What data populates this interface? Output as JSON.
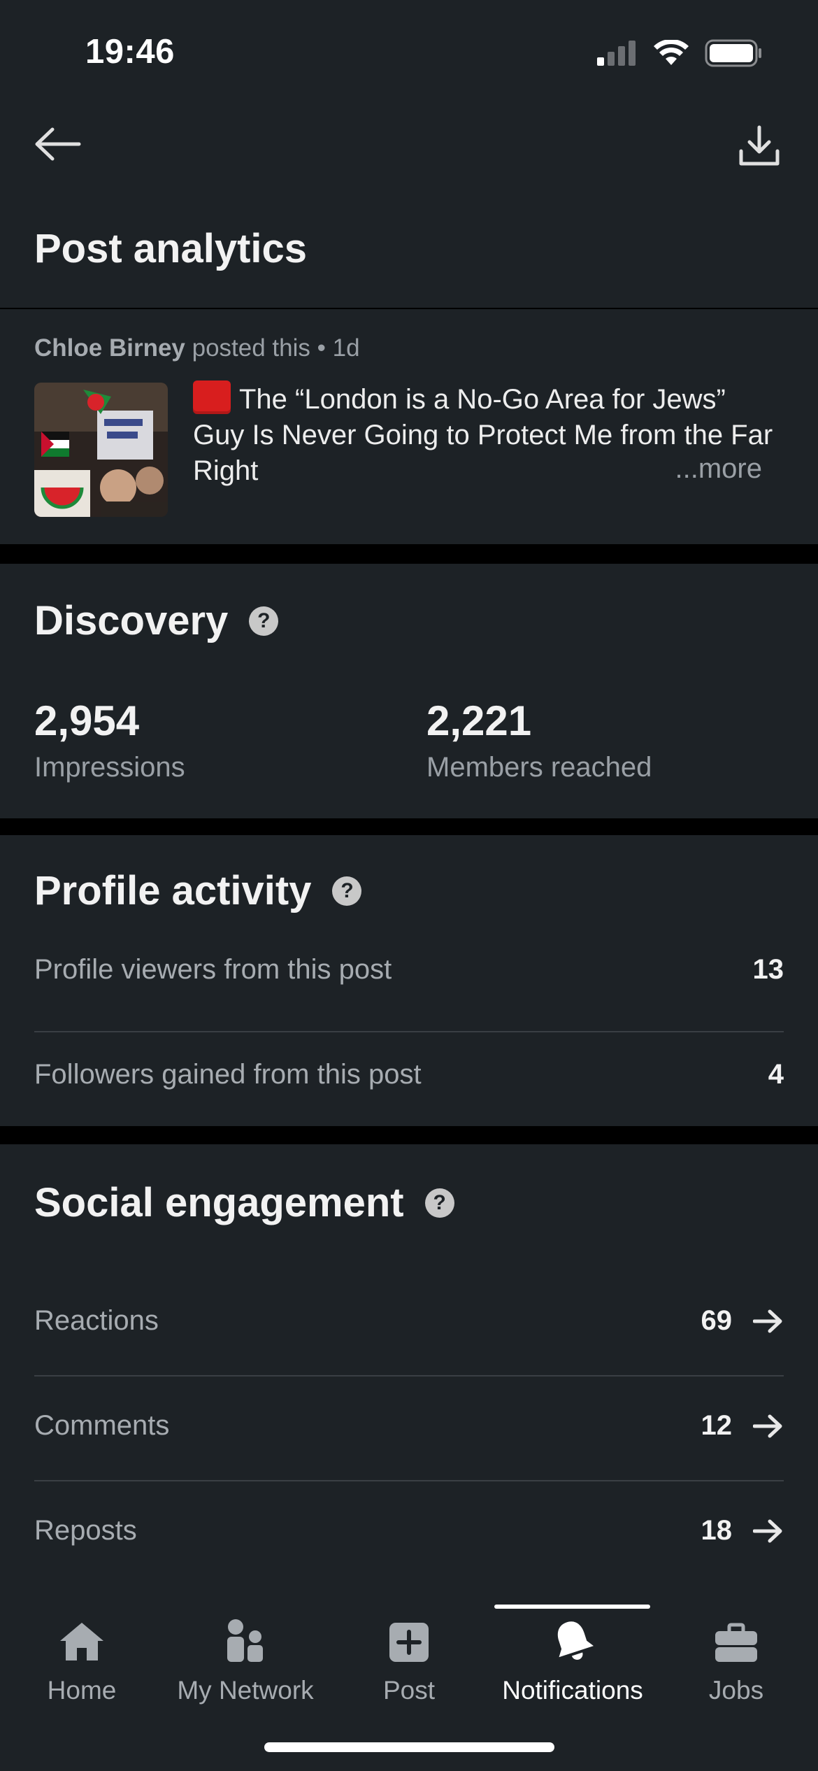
{
  "status_bar": {
    "time": "19:46"
  },
  "header": {
    "title": "Post analytics"
  },
  "post": {
    "author": "Chloe Birney",
    "meta_suffix": "posted this • 1d",
    "text": "The “London is a No-Go Area for Jews” Guy Is Never Going to Protect Me from the Far Right",
    "more_label": "...more"
  },
  "discovery": {
    "title": "Discovery",
    "help": "?",
    "impressions_value": "2,954",
    "impressions_label": "Impressions",
    "reached_value": "2,221",
    "reached_label": "Members reached"
  },
  "profile_activity": {
    "title": "Profile activity",
    "help": "?",
    "rows": [
      {
        "label": "Profile viewers from this post",
        "value": "13"
      },
      {
        "label": "Followers gained from this post",
        "value": "4"
      }
    ]
  },
  "social_engagement": {
    "title": "Social engagement",
    "help": "?",
    "rows": [
      {
        "label": "Reactions",
        "value": "69"
      },
      {
        "label": "Comments",
        "value": "12"
      },
      {
        "label": "Reposts",
        "value": "18"
      }
    ]
  },
  "nav": {
    "items": [
      {
        "label": "Home",
        "icon": "home-icon"
      },
      {
        "label": "My Network",
        "icon": "network-icon"
      },
      {
        "label": "Post",
        "icon": "post-icon"
      },
      {
        "label": "Notifications",
        "icon": "bell-icon",
        "active": true
      },
      {
        "label": "Jobs",
        "icon": "briefcase-icon"
      }
    ]
  },
  "colors": {
    "background": "#1d2226",
    "separator": "#000000",
    "muted_text": "#9aa0a6"
  }
}
